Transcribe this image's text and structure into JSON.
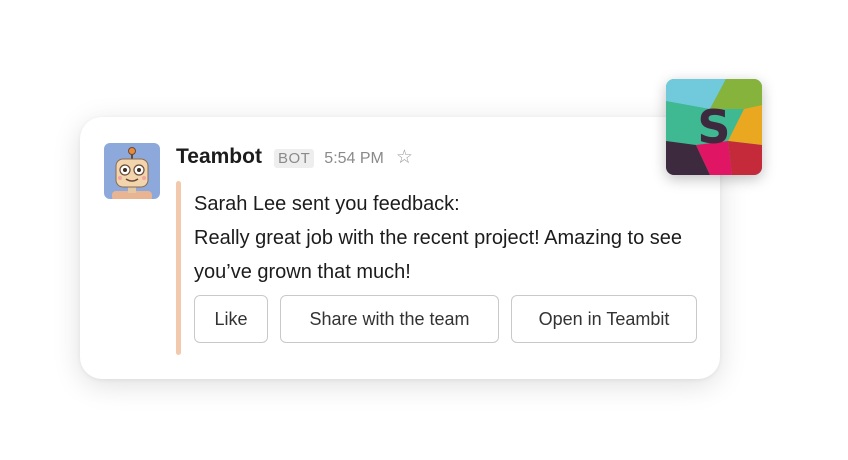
{
  "message": {
    "sender": "Teambot",
    "badge": "BOT",
    "time": "5:54 PM",
    "title": "Sarah Lee sent you feedback:",
    "text": "Really great job with the recent project! Amazing to see you’ve grown that much!",
    "accent_color": "#f2c9ad"
  },
  "actions": [
    {
      "label": "Like"
    },
    {
      "label": "Share with the team"
    },
    {
      "label": "Open in Teambit"
    }
  ],
  "icons": {
    "star": "star-outline-icon",
    "avatar": "robot-avatar",
    "app_logo": "slack-logo"
  },
  "colors": {
    "text": "#1d1c1d",
    "muted": "#8a8a8a",
    "slack_teal": "#3eb991",
    "slack_blue": "#70cadb",
    "slack_yellow": "#e9a820",
    "slack_pink": "#e01563",
    "slack_purple": "#3d2a3e"
  }
}
